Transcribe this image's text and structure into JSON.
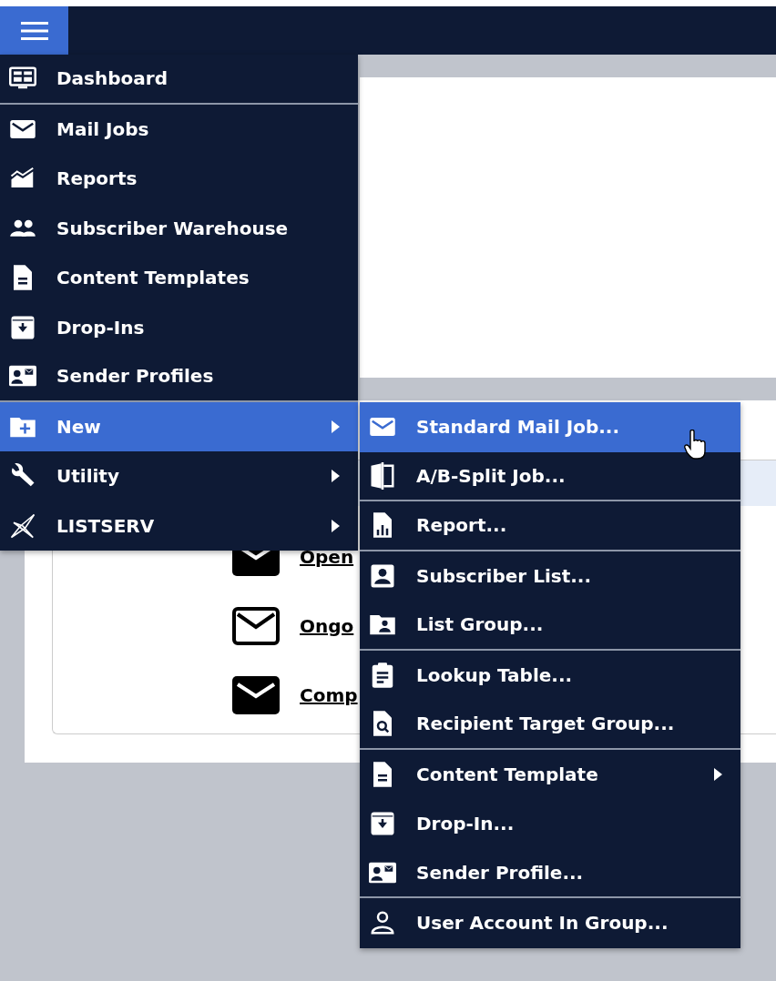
{
  "main_menu": [
    {
      "label": "Dashboard",
      "selected": false,
      "submenu": false,
      "separator_after": true
    },
    {
      "label": "Mail Jobs",
      "selected": false,
      "submenu": false,
      "separator_after": false
    },
    {
      "label": "Reports",
      "selected": false,
      "submenu": false,
      "separator_after": false
    },
    {
      "label": "Subscriber Warehouse",
      "selected": false,
      "submenu": false,
      "separator_after": false
    },
    {
      "label": "Content Templates",
      "selected": false,
      "submenu": false,
      "separator_after": false
    },
    {
      "label": "Drop-Ins",
      "selected": false,
      "submenu": false,
      "separator_after": false
    },
    {
      "label": "Sender Profiles",
      "selected": false,
      "submenu": false,
      "separator_after": true
    },
    {
      "label": "New",
      "selected": true,
      "submenu": true,
      "separator_after": false
    },
    {
      "label": "Utility",
      "selected": false,
      "submenu": true,
      "separator_after": false
    },
    {
      "label": "LISTSERV",
      "selected": false,
      "submenu": true,
      "separator_after": false
    }
  ],
  "new_submenu": [
    {
      "label": "Standard Mail Job...",
      "selected": true,
      "submenu": false,
      "separator_after": false
    },
    {
      "label": "A/B-Split Job...",
      "selected": false,
      "submenu": false,
      "separator_after": true
    },
    {
      "label": "Report...",
      "selected": false,
      "submenu": false,
      "separator_after": true
    },
    {
      "label": "Subscriber List...",
      "selected": false,
      "submenu": false,
      "separator_after": false
    },
    {
      "label": "List Group...",
      "selected": false,
      "submenu": false,
      "separator_after": true
    },
    {
      "label": "Lookup Table...",
      "selected": false,
      "submenu": false,
      "separator_after": false
    },
    {
      "label": "Recipient Target Group...",
      "selected": false,
      "submenu": false,
      "separator_after": true
    },
    {
      "label": "Content Template",
      "selected": false,
      "submenu": true,
      "separator_after": false
    },
    {
      "label": "Drop-In...",
      "selected": false,
      "submenu": false,
      "separator_after": false
    },
    {
      "label": "Sender Profile...",
      "selected": false,
      "submenu": false,
      "separator_after": true
    },
    {
      "label": "User Account In Group...",
      "selected": false,
      "submenu": false,
      "separator_after": false
    }
  ],
  "background_links": [
    {
      "label": "Open",
      "kind": "filled"
    },
    {
      "label": "Ongo",
      "kind": "outline"
    },
    {
      "label": "Comp",
      "kind": "filled"
    }
  ]
}
